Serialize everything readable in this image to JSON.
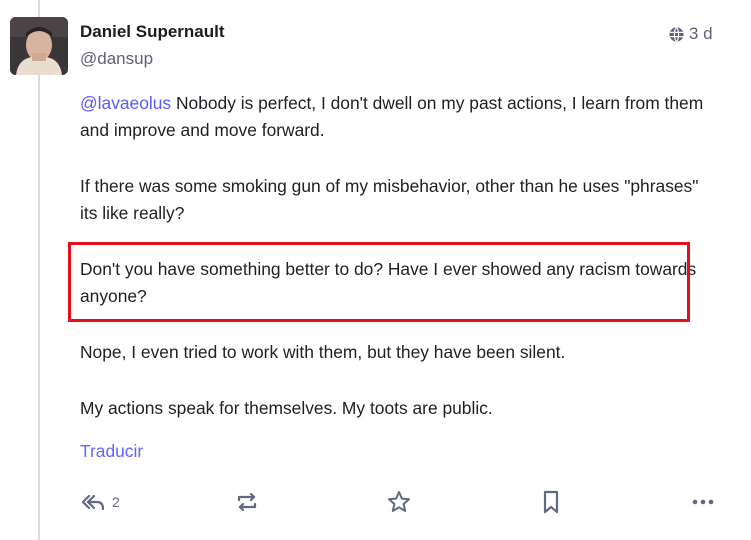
{
  "post": {
    "author_name": "Daniel Supernault",
    "author_handle": "@dansup",
    "visibility_icon": "globe-icon",
    "time_ago": "3 d",
    "mention": "@lavaeolus",
    "paragraphs": [
      " Nobody is perfect, I don't dwell on my past actions, I learn from them and improve and move forward.",
      "If there was some smoking gun of my misbehavior, other than he uses \"phrases\" its like really?",
      "Don't you have something better to do? Have I ever showed any racism towards anyone?",
      "Nope, I even tried to work with them, but they have been silent.",
      "My actions speak for themselves. My toots are public."
    ],
    "translate_label": "Traducir"
  },
  "actions": {
    "reply_count": "2",
    "icons": [
      "reply-all-icon",
      "boost-icon",
      "star-icon",
      "bookmark-icon",
      "more-icon"
    ]
  },
  "colors": {
    "mention": "#595aff",
    "highlight_border": "#e5101d",
    "secondary_text": "#5e6178"
  }
}
